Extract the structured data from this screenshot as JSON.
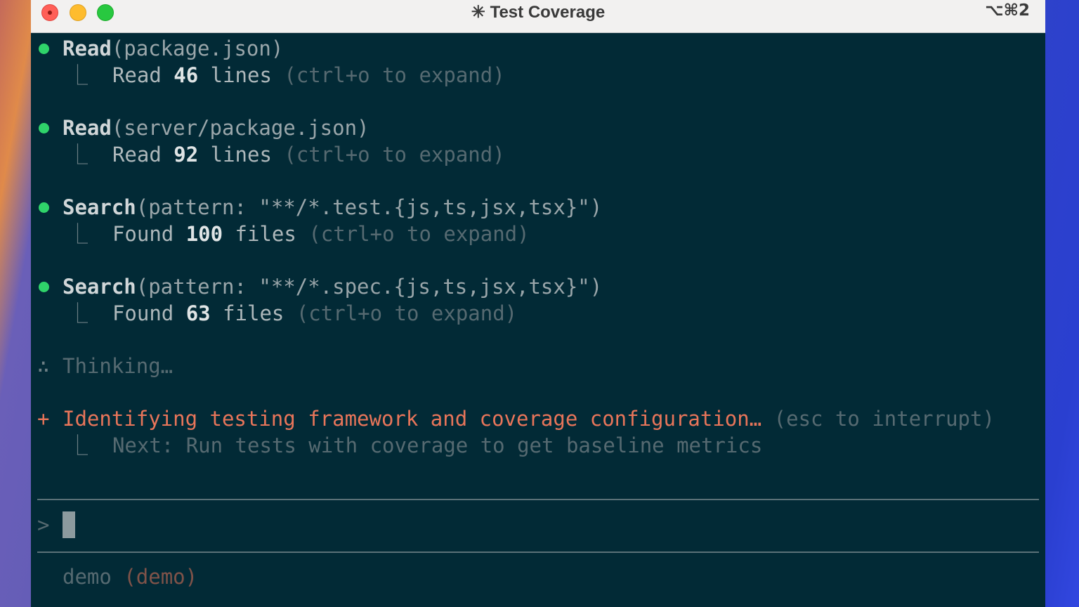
{
  "window": {
    "title_icon": "✳",
    "title": "Test Coverage",
    "shortcut": "⌥⌘2"
  },
  "entries": [
    {
      "tool": "Read",
      "args": "(package.json)",
      "result_prefix": "Read ",
      "result_count": "46",
      "result_suffix": " lines ",
      "hint": "(ctrl+o to expand)"
    },
    {
      "tool": "Read",
      "args": "(server/package.json)",
      "result_prefix": "Read ",
      "result_count": "92",
      "result_suffix": " lines ",
      "hint": "(ctrl+o to expand)"
    },
    {
      "tool": "Search",
      "args": "(pattern: \"**/*.test.{js,ts,jsx,tsx}\")",
      "result_prefix": "Found ",
      "result_count": "100",
      "result_suffix": " files ",
      "hint": "(ctrl+o to expand)"
    },
    {
      "tool": "Search",
      "args": "(pattern: \"**/*.spec.{js,ts,jsx,tsx}\")",
      "result_prefix": "Found ",
      "result_count": "63",
      "result_suffix": " files ",
      "hint": "(ctrl+o to expand)"
    }
  ],
  "thinking": {
    "icon": "∴",
    "text": "Thinking…"
  },
  "status": {
    "icon": "+",
    "text": "Identifying testing framework and coverage configuration…",
    "hint": " (esc to interrupt)",
    "next": "Next: Run tests with coverage to get baseline metrics"
  },
  "elbow_glyph": "⎿",
  "prompt": {
    "symbol": ">",
    "value": ""
  },
  "footer": {
    "name": "demo",
    "branch": "(demo)"
  },
  "colors": {
    "terminal_bg": "#022a36",
    "bullet": "#2fd36a",
    "status_accent": "#e8755a"
  }
}
